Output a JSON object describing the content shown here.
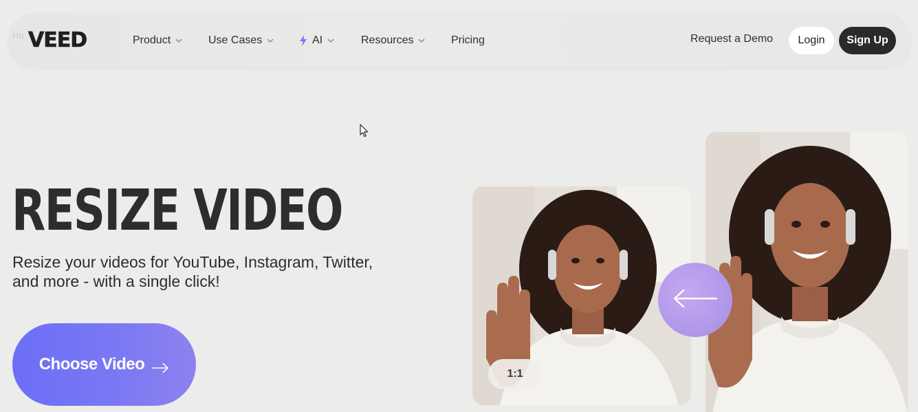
{
  "nav": {
    "ghost_text": "Ho",
    "logo": "VEED",
    "items": [
      {
        "label": "Product",
        "has_dropdown": true,
        "icon": "chevron-down-icon"
      },
      {
        "label": "Use Cases",
        "has_dropdown": true,
        "icon": "chevron-down-icon"
      },
      {
        "label": "AI",
        "has_dropdown": true,
        "icon": "chevron-down-icon",
        "prefix_icon": "lightning-bolt-icon"
      },
      {
        "label": "Resources",
        "has_dropdown": true,
        "icon": "chevron-down-icon"
      },
      {
        "label": "Pricing",
        "has_dropdown": false
      }
    ],
    "demo_link": "Request a Demo",
    "login": "Login",
    "signup": "Sign Up"
  },
  "hero": {
    "title": "RESIZE VIDEO",
    "subtitle": "Resize your videos for YouTube, Instagram, Twitter, and more - with a single click!",
    "cta": "Choose Video",
    "cta_icon": "arrow-right-icon"
  },
  "preview": {
    "ratio_badge": "1:1",
    "switch_icon": "arrow-left-icon"
  },
  "colors": {
    "background": "#ececea",
    "cta_gradient_start": "#6b6ef7",
    "cta_gradient_end": "#8d82ee",
    "signup_bg": "#2a2a2a",
    "ai_bolt": "#8a6cf0",
    "switch_circle": "#b39aea"
  }
}
